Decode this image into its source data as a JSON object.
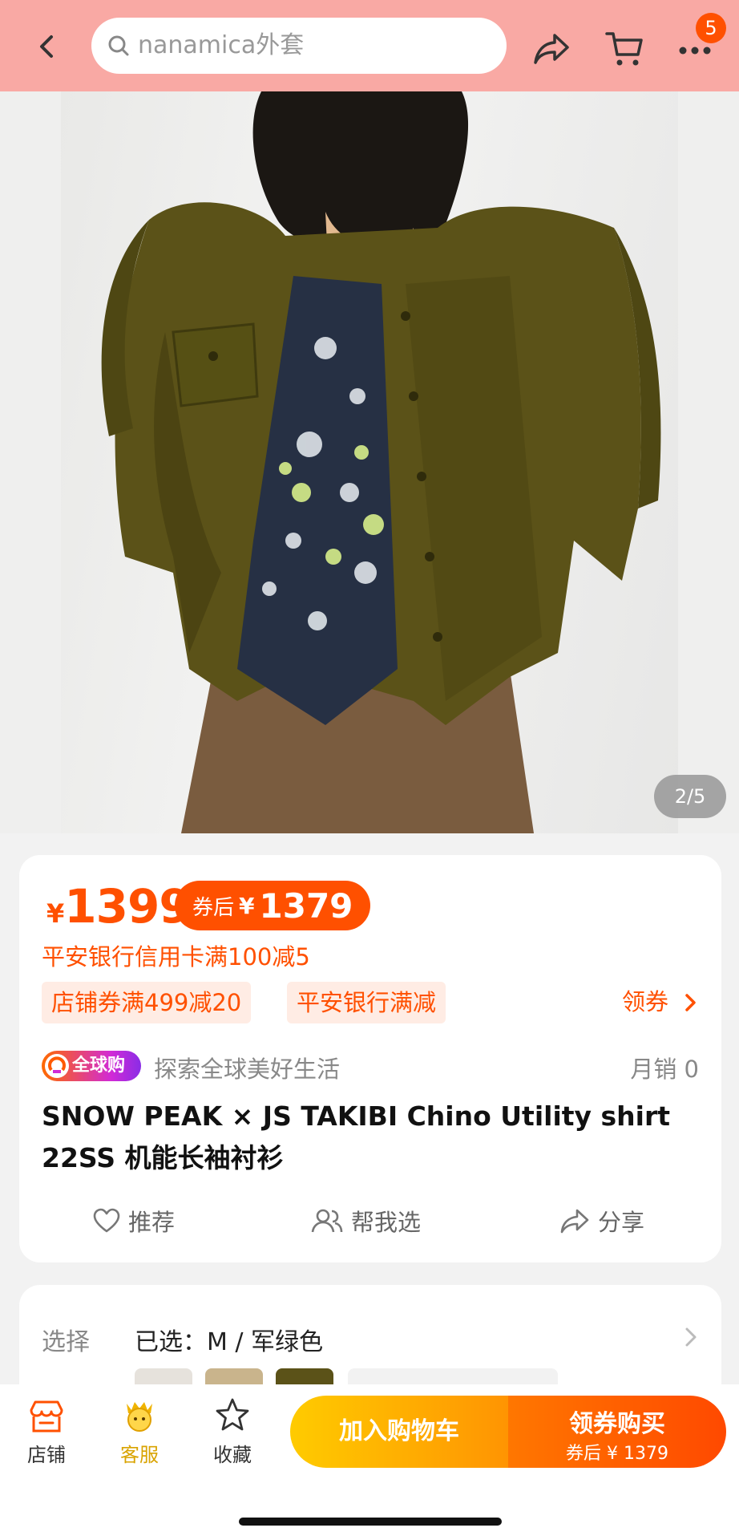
{
  "header": {
    "search_text": "nanamica外套",
    "cart_badge": "5"
  },
  "gallery": {
    "counter": "2/5"
  },
  "price": {
    "currency": "¥",
    "amount": "1399",
    "after_coupon_label": "券后",
    "after_coupon_currency": "¥",
    "after_coupon_amount": "1379"
  },
  "promo_line": "平安银行信用卡满100减5",
  "tags": [
    "店铺券满499减20",
    "平安银行满减"
  ],
  "get_coupon": "领券",
  "global_badge": "全球购",
  "slogan": "探索全球美好生活",
  "monthly_sales": "月销 0",
  "product_title": "SNOW PEAK × JS TAKIBI Chino Utility shirt 22SS 机能长袖衬衫",
  "actions": {
    "recommend": "推荐",
    "help_choose": "帮我选",
    "share": "分享"
  },
  "selection": {
    "label": "选择",
    "value": "已选：M / 军绿色"
  },
  "bottom": {
    "store": "店铺",
    "service": "客服",
    "favorite": "收藏",
    "add_cart": "加入购物车",
    "buy": "领券购买",
    "buy_sub": "券后 ¥ 1379"
  },
  "colors": {
    "accent": "#ff5000",
    "header_bg": "#f9a9a4",
    "cart_btn": "#ffb000",
    "buy_btn": "#ff5a00",
    "jacket": "#5b5218"
  }
}
